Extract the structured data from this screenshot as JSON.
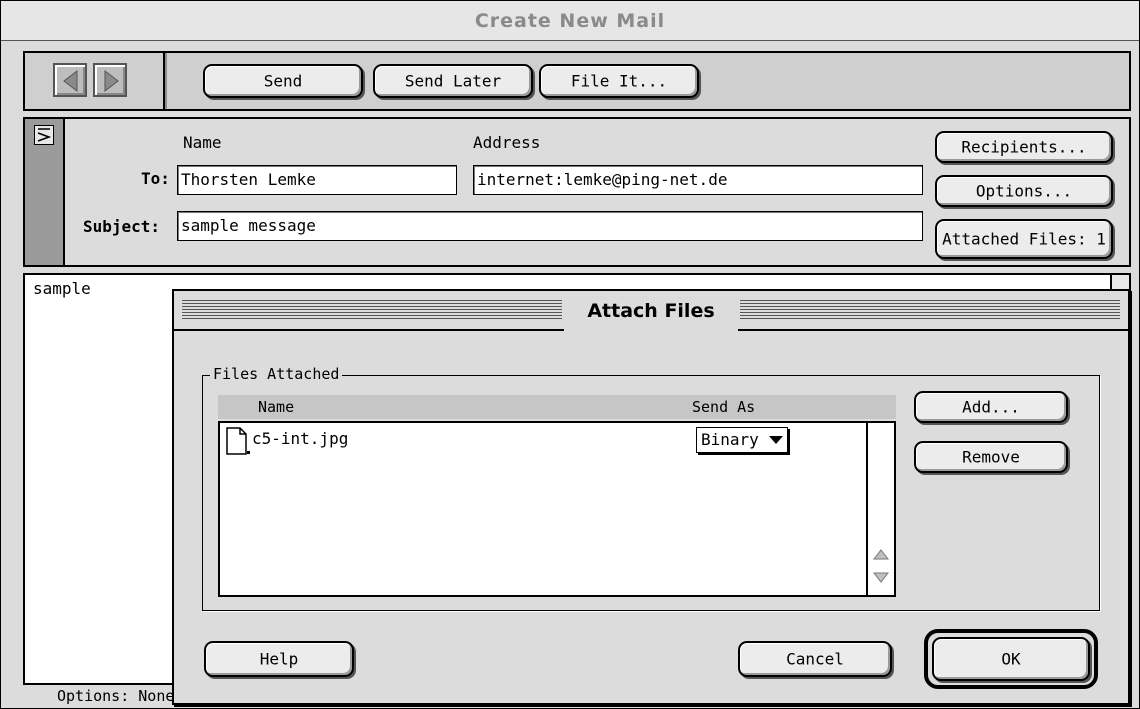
{
  "window": {
    "title": "Create New Mail"
  },
  "toolbar": {
    "back_icon": "left-arrow-icon",
    "forward_icon": "right-arrow-icon",
    "send_label": "Send",
    "send_later_label": "Send Later",
    "file_it_label": "File It..."
  },
  "header": {
    "name_col_label": "Name",
    "address_col_label": "Address",
    "to_label": "To:",
    "to_name": "Thorsten Lemke",
    "to_address": "internet:lemke@ping-net.de",
    "subject_label": "Subject:",
    "subject_value": "sample message",
    "recipients_label": "Recipients...",
    "options_label": "Options...",
    "attached_files_label": "Attached Files: 1"
  },
  "body": {
    "text": "sample"
  },
  "status": {
    "options_text": "Options: None"
  },
  "dialog": {
    "title": "Attach Files",
    "group_label": "Files Attached",
    "columns": {
      "name": "Name",
      "send_as": "Send As"
    },
    "files": [
      {
        "name": "c5-int.jpg",
        "send_as": "Binary"
      }
    ],
    "add_label": "Add...",
    "remove_label": "Remove",
    "help_label": "Help",
    "cancel_label": "Cancel",
    "ok_label": "OK"
  }
}
